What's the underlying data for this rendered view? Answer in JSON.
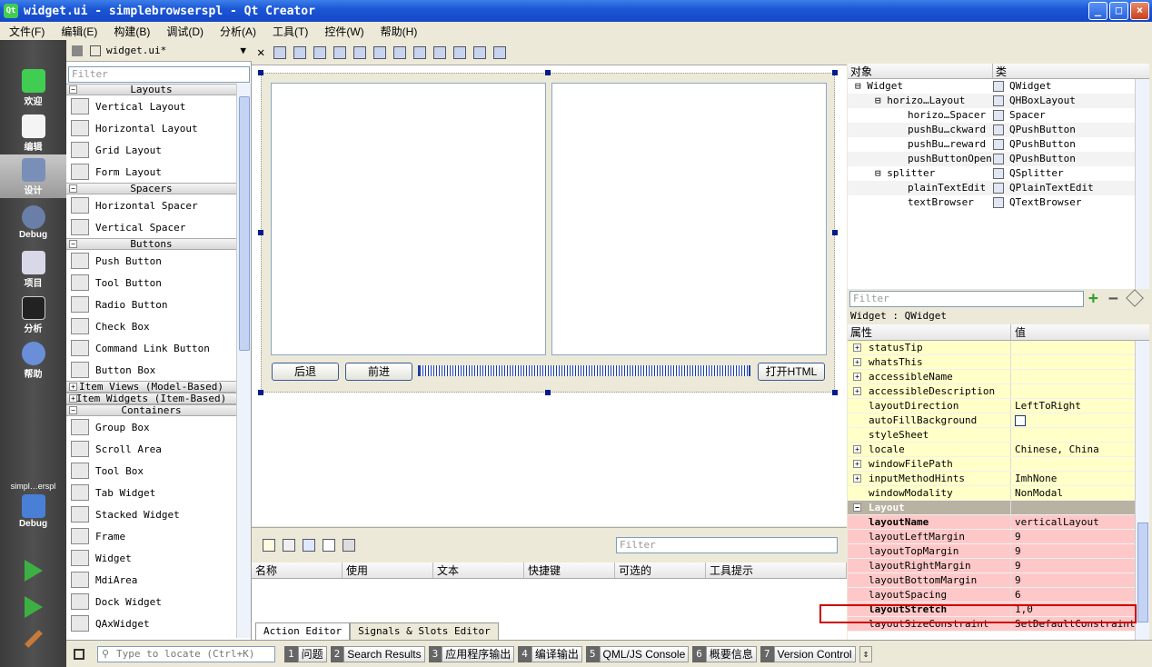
{
  "window": {
    "title": "widget.ui - simplebrowserspl - Qt Creator",
    "app_icon": "Qt"
  },
  "menu": [
    "文件(F)",
    "编辑(E)",
    "构建(B)",
    "调试(D)",
    "分析(A)",
    "工具(T)",
    "控件(W)",
    "帮助(H)"
  ],
  "modes": [
    {
      "label": "欢迎",
      "icon": "welcome-icon"
    },
    {
      "label": "编辑",
      "icon": "edit-icon"
    },
    {
      "label": "设计",
      "icon": "design-icon"
    },
    {
      "label": "Debug",
      "icon": "debug-icon"
    },
    {
      "label": "项目",
      "icon": "project-icon"
    },
    {
      "label": "分析",
      "icon": "analyze-icon"
    },
    {
      "label": "帮助",
      "icon": "help-icon"
    }
  ],
  "kit": {
    "project": "simpl…erspl",
    "config": "Debug"
  },
  "file_tab": "widget.ui*",
  "widget_box": {
    "filter_placeholder": "Filter",
    "categories": [
      {
        "title": "Layouts",
        "items": [
          "Vertical Layout",
          "Horizontal Layout",
          "Grid Layout",
          "Form Layout"
        ]
      },
      {
        "title": "Spacers",
        "items": [
          "Horizontal Spacer",
          "Vertical Spacer"
        ]
      },
      {
        "title": "Buttons",
        "items": [
          "Push Button",
          "Tool Button",
          "Radio Button",
          "Check Box",
          "Command Link Button",
          "Button Box"
        ]
      }
    ],
    "collapsed": [
      "Item Views (Model-Based)",
      "Item Widgets (Item-Based)"
    ],
    "containers_title": "Containers",
    "containers": [
      "Group Box",
      "Scroll Area",
      "Tool Box",
      "Tab Widget",
      "Stacked Widget",
      "Frame",
      "Widget",
      "MdiArea",
      "Dock Widget",
      "QAxWidget"
    ]
  },
  "form": {
    "back": "后退",
    "forward": "前进",
    "open": "打开HTML"
  },
  "action_editor": {
    "filter_placeholder": "Filter",
    "columns": [
      "名称",
      "使用",
      "文本",
      "快捷键",
      "可选的",
      "工具提示"
    ],
    "tabs": [
      "Action Editor",
      "Signals & Slots Editor"
    ]
  },
  "object_inspector": {
    "headers": [
      "对象",
      "类"
    ],
    "rows": [
      {
        "name": "Widget",
        "class": "QWidget",
        "indent": 0
      },
      {
        "name": "horizo…Layout",
        "class": "QHBoxLayout",
        "indent": 1
      },
      {
        "name": "horizo…Spacer",
        "class": "Spacer",
        "indent": 2
      },
      {
        "name": "pushBu…ckward",
        "class": "QPushButton",
        "indent": 2
      },
      {
        "name": "pushBu…reward",
        "class": "QPushButton",
        "indent": 2
      },
      {
        "name": "pushButtonOpen",
        "class": "QPushButton",
        "indent": 2
      },
      {
        "name": "splitter",
        "class": "QSplitter",
        "indent": 1
      },
      {
        "name": "plainTextEdit",
        "class": "QPlainTextEdit",
        "indent": 2
      },
      {
        "name": "textBrowser",
        "class": "QTextBrowser",
        "indent": 2
      }
    ]
  },
  "property_editor": {
    "filter_placeholder": "Filter",
    "class_line": "Widget : QWidget",
    "headers": [
      "属性",
      "值"
    ],
    "rows": [
      {
        "key": "statusTip",
        "value": "",
        "plus": true,
        "style": "y"
      },
      {
        "key": "whatsThis",
        "value": "",
        "plus": true,
        "style": "y"
      },
      {
        "key": "accessibleName",
        "value": "",
        "plus": true,
        "style": "y"
      },
      {
        "key": "accessibleDescription",
        "value": "",
        "plus": true,
        "style": "y"
      },
      {
        "key": "layoutDirection",
        "value": "LeftToRight",
        "plus": false,
        "style": "y"
      },
      {
        "key": "autoFillBackground",
        "value": "",
        "plus": false,
        "style": "y",
        "checkbox": true
      },
      {
        "key": "styleSheet",
        "value": "",
        "plus": false,
        "style": "y"
      },
      {
        "key": "locale",
        "value": "Chinese, China",
        "plus": true,
        "style": "y"
      },
      {
        "key": "windowFilePath",
        "value": "",
        "plus": true,
        "style": "y"
      },
      {
        "key": "inputMethodHints",
        "value": "ImhNone",
        "plus": true,
        "style": "y"
      },
      {
        "key": "windowModality",
        "value": "NonModal",
        "plus": false,
        "style": "y"
      },
      {
        "key": "Layout",
        "value": "",
        "plus": false,
        "style": "grp"
      },
      {
        "key": "layoutName",
        "value": "verticalLayout",
        "plus": false,
        "style": "r",
        "bold": true
      },
      {
        "key": "layoutLeftMargin",
        "value": "9",
        "plus": false,
        "style": "r"
      },
      {
        "key": "layoutTopMargin",
        "value": "9",
        "plus": false,
        "style": "r"
      },
      {
        "key": "layoutRightMargin",
        "value": "9",
        "plus": false,
        "style": "r"
      },
      {
        "key": "layoutBottomMargin",
        "value": "9",
        "plus": false,
        "style": "r"
      },
      {
        "key": "layoutSpacing",
        "value": "6",
        "plus": false,
        "style": "r"
      },
      {
        "key": "layoutStretch",
        "value": "1,0",
        "plus": false,
        "style": "r",
        "bold": true
      },
      {
        "key": "layoutSizeConstraint",
        "value": "SetDefaultConstraint",
        "plus": false,
        "style": "r"
      }
    ]
  },
  "statusbar": {
    "locate_placeholder": "Type to locate (Ctrl+K)",
    "panes": [
      {
        "n": "1",
        "label": "问题"
      },
      {
        "n": "2",
        "label": "Search Results"
      },
      {
        "n": "3",
        "label": "应用程序输出"
      },
      {
        "n": "4",
        "label": "编译输出"
      },
      {
        "n": "5",
        "label": "QML/JS Console"
      },
      {
        "n": "6",
        "label": "概要信息"
      },
      {
        "n": "7",
        "label": "Version Control"
      }
    ]
  },
  "colors": {
    "accent_highlight": "#cc0000",
    "title_bar": "#1c57d6",
    "property_yellow": "#ffffc8",
    "property_red": "#ffc8c8"
  }
}
